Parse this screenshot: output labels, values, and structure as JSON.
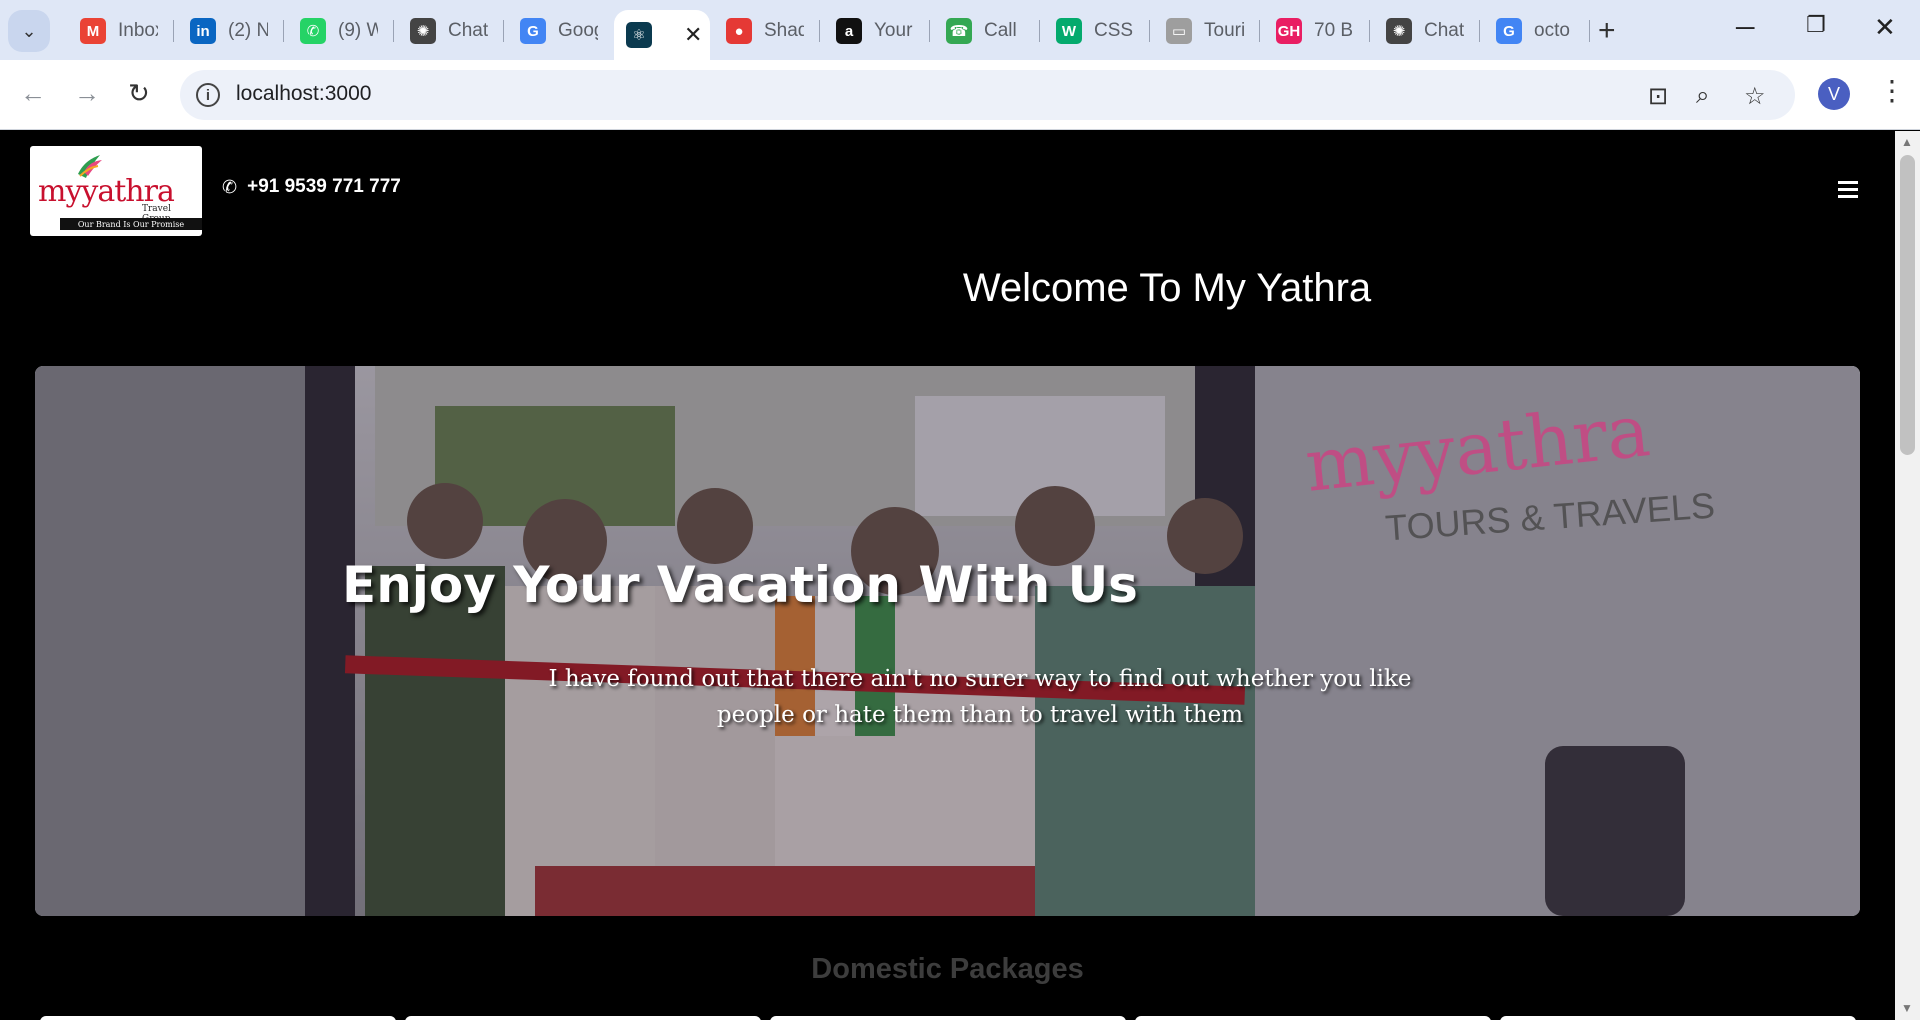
{
  "browser": {
    "tabs": [
      {
        "label": "Inbox",
        "icon": "gmail-icon",
        "color": "#ea4335"
      },
      {
        "label": "(2) N",
        "icon": "linkedin-icon",
        "color": "#0a66c2"
      },
      {
        "label": "(9) W",
        "icon": "whatsapp-icon",
        "color": "#25d366"
      },
      {
        "label": "Chat",
        "icon": "chatgpt-icon",
        "color": "#444444"
      },
      {
        "label": "Goog",
        "icon": "google-translate-icon",
        "color": "#4285f4"
      },
      {
        "label": "",
        "icon": "react-icon",
        "color": "#0b3a4f",
        "active": true
      },
      {
        "label": "Shad",
        "icon": "record-icon",
        "color": "#e53935"
      },
      {
        "label": "Your",
        "icon": "amazon-icon",
        "color": "#111111"
      },
      {
        "label": "Call",
        "icon": "call-icon",
        "color": "#34a853"
      },
      {
        "label": "CSS",
        "icon": "w3schools-icon",
        "color": "#04aa6d"
      },
      {
        "label": "Touri",
        "icon": "css-icon",
        "color": "#9e9e9e"
      },
      {
        "label": "70 B",
        "icon": "gh-icon",
        "color": "#e91e63"
      },
      {
        "label": "Chat",
        "icon": "chatgpt-icon",
        "color": "#444444"
      },
      {
        "label": "octo",
        "icon": "google-icon",
        "color": "#4285f4"
      }
    ],
    "url": "localhost:3000",
    "profile_initial": "V"
  },
  "site": {
    "logo": {
      "brand": "myyathra",
      "sub": "Travel Group",
      "tagline": "Our Brand Is Our Promise"
    },
    "phone": "+91 9539 771 777",
    "welcome": "Welcome To My Yathra",
    "hero": {
      "heading": "Enjoy Your Vacation With Us",
      "text": "I have found out that there ain't no surer way to find out whether you like people or hate them than to travel with them",
      "storefront_brand": "myyathra",
      "storefront_sub": "TOURS & TRAVELS"
    },
    "section_title": "Domestic Packages"
  }
}
